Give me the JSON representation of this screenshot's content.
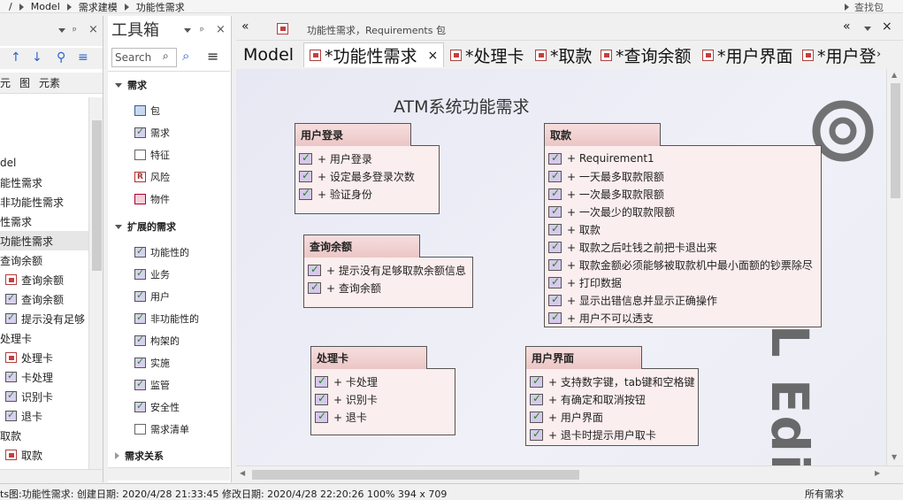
{
  "breadcrumb": [
    "/",
    "Model",
    "需求建模",
    "功能性需求"
  ],
  "find_label": "查找包",
  "left": {
    "tabs": [
      "元",
      "图",
      "元素"
    ],
    "items": [
      {
        "label": "del",
        "indent": 0,
        "icon": "none"
      },
      {
        "label": "能性需求",
        "indent": 0,
        "icon": "none"
      },
      {
        "label": "非功能性需求",
        "indent": 0,
        "icon": "none"
      },
      {
        "label": "性需求",
        "indent": 0,
        "icon": "none"
      },
      {
        "label": "功能性需求",
        "indent": 0,
        "icon": "none",
        "selected": true
      },
      {
        "label": "查询余额",
        "indent": 0,
        "icon": "none"
      },
      {
        "label": "查询余额",
        "indent": 1,
        "icon": "pkg"
      },
      {
        "label": "查询余额",
        "indent": 1,
        "icon": "req"
      },
      {
        "label": "提示没有足够",
        "indent": 1,
        "icon": "req"
      },
      {
        "label": "处理卡",
        "indent": 0,
        "icon": "none"
      },
      {
        "label": "处理卡",
        "indent": 1,
        "icon": "pkg"
      },
      {
        "label": "卡处理",
        "indent": 1,
        "icon": "req"
      },
      {
        "label": "识别卡",
        "indent": 1,
        "icon": "req"
      },
      {
        "label": "退卡",
        "indent": 1,
        "icon": "req"
      },
      {
        "label": "取款",
        "indent": 0,
        "icon": "none"
      },
      {
        "label": "取款",
        "indent": 1,
        "icon": "pkg"
      }
    ]
  },
  "toolbox": {
    "title": "工具箱",
    "search_placeholder": "Search",
    "groups": [
      {
        "title": "需求",
        "items": [
          "包",
          "需求",
          "特征",
          "风险",
          "物件"
        ]
      },
      {
        "title": "扩展的需求",
        "items": [
          "功能性的",
          "业务",
          "用户",
          "非功能性的",
          "构架的",
          "实施",
          "监管",
          "安全性",
          "需求清单"
        ]
      },
      {
        "title": "需求关系",
        "items": []
      }
    ]
  },
  "diagram": {
    "header_label": "功能性需求，Requirements 包",
    "tabs": [
      "Model",
      "*功能性需求",
      "*处理卡",
      "*取款",
      "*查询余额",
      "*用户界面",
      "*用户登"
    ],
    "title": "ATM系统功能需求",
    "boxes": [
      {
        "name": "用户登录",
        "rows": [
          "+ 用户登录",
          "+ 设定最多登录次数",
          "+ 验证身份"
        ]
      },
      {
        "name": "查询余额",
        "rows": [
          "+ 提示没有足够取款余额信息",
          "+ 查询余额"
        ]
      },
      {
        "name": "处理卡",
        "rows": [
          "+ 卡处理",
          "+ 识别卡",
          "+ 退卡"
        ]
      },
      {
        "name": "取款",
        "rows": [
          "+ Requirement1",
          "+ 一天最多取款限额",
          "+ 一次最多取款限额",
          "+ 一次最少的取款限额",
          "+ 取款",
          "+ 取款之后吐钱之前把卡退出来",
          "+ 取款金额必须能够被取款机中最小面额的钞票除尽",
          "+ 打印数据",
          "+ 显示出错信息并显示正确操作",
          "+ 用户不可以透支"
        ]
      },
      {
        "name": "用户界面",
        "rows": [
          "+ 支持数字键，tab键和空格键",
          "+ 有确定和取消按钮",
          "+ 用户界面",
          "+ 退卡时提示用户取卡"
        ]
      }
    ],
    "watermark": "TRIAL Editi"
  },
  "status": {
    "text": "ts图:功能性需求:  创建日期: 2020/4/28 21:33:45  修改日期: 2020/4/28 22:20:26  100%  394 x 709",
    "right": "所有需求"
  },
  "colors": {
    "accent": "#f6dede",
    "check": "#1c8a1c"
  }
}
